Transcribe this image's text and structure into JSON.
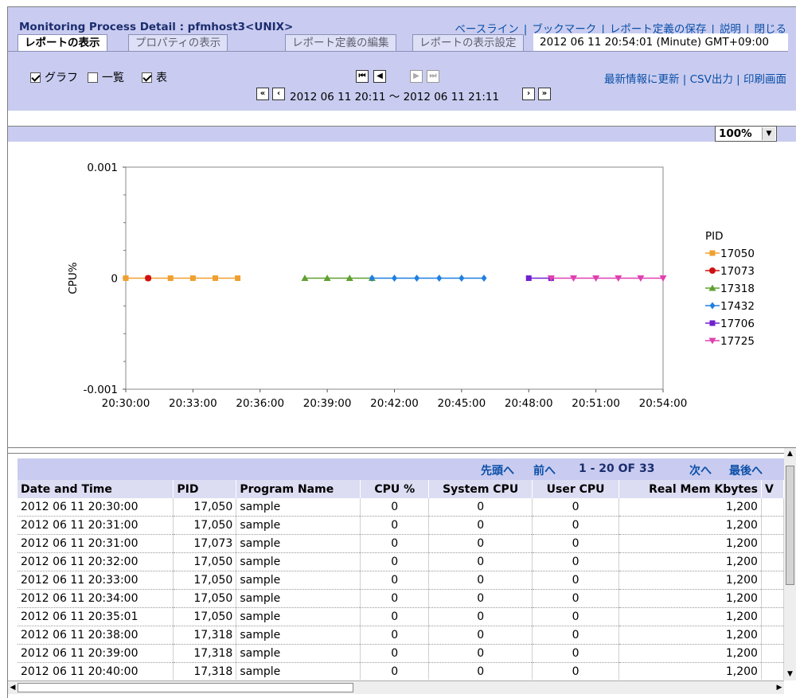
{
  "header": {
    "title": "Monitoring Process Detail : pfmhost3<UNIX>",
    "top_links": [
      "ベースライン",
      "ブックマーク",
      "レポート定義の保存",
      "説明",
      "閉じる"
    ],
    "tabs": [
      "レポートの表示",
      "プロパティの表示",
      "レポート定義の編集",
      "レポートの表示設定"
    ],
    "report_time": "2012 06 11 20:54:01  (Minute)  GMT+09:00",
    "checkboxes": [
      {
        "label": "グラフ",
        "checked": true
      },
      {
        "label": "一覧",
        "checked": false
      },
      {
        "label": "表",
        "checked": true
      }
    ],
    "range_text": "2012 06 11 20:11 ～ 2012 06 11 21:11",
    "right_links": [
      "最新情報に更新",
      "CSV出力",
      "印刷画面"
    ]
  },
  "graph": {
    "zoom": "100%"
  },
  "chart_data": {
    "type": "line",
    "ylabel": "CPU%",
    "xlabel": "",
    "ylim": [
      -0.001,
      0.001
    ],
    "yticks": [
      "0.001",
      "0",
      "-0.001"
    ],
    "xticks": [
      "20:30:00",
      "20:33:00",
      "20:36:00",
      "20:39:00",
      "20:42:00",
      "20:45:00",
      "20:48:00",
      "20:51:00",
      "20:54:00"
    ],
    "legend_title": "PID",
    "legend_position": "right",
    "series": [
      {
        "name": "17050",
        "color": "#f0a030",
        "marker": "square",
        "x": [
          "20:30:00",
          "20:31:00",
          "20:32:00",
          "20:33:00",
          "20:34:00",
          "20:35:00"
        ],
        "y": [
          0,
          0,
          0,
          0,
          0,
          0
        ]
      },
      {
        "name": "17073",
        "color": "#d01010",
        "marker": "circle",
        "x": [
          "20:31:00"
        ],
        "y": [
          0
        ]
      },
      {
        "name": "17318",
        "color": "#60a030",
        "marker": "triangle",
        "x": [
          "20:38:00",
          "20:39:00",
          "20:40:00",
          "20:41:00"
        ],
        "y": [
          0,
          0,
          0,
          0
        ]
      },
      {
        "name": "17432",
        "color": "#2080e0",
        "marker": "diamond",
        "x": [
          "20:41:00",
          "20:42:00",
          "20:43:00",
          "20:44:00",
          "20:45:00",
          "20:46:00"
        ],
        "y": [
          0,
          0,
          0,
          0,
          0,
          0
        ]
      },
      {
        "name": "17706",
        "color": "#7020d0",
        "marker": "square",
        "x": [
          "20:48:00",
          "20:49:00"
        ],
        "y": [
          0,
          0
        ]
      },
      {
        "name": "17725",
        "color": "#e040b0",
        "marker": "triangle-down",
        "x": [
          "20:49:00",
          "20:50:00",
          "20:51:00",
          "20:52:00",
          "20:53:00",
          "20:54:00"
        ],
        "y": [
          0,
          0,
          0,
          0,
          0,
          0
        ]
      }
    ]
  },
  "pager": {
    "first": "先頭へ",
    "prev": "前へ",
    "range": "1 - 20 OF 33",
    "next": "次へ",
    "last": "最後へ"
  },
  "table": {
    "columns": [
      "Date and Time",
      "PID",
      "Program Name",
      "CPU %",
      "System CPU",
      "User CPU",
      "Real Mem Kbytes",
      "V"
    ],
    "rows": [
      [
        "2012 06 11 20:30:00",
        "17,050",
        "sample",
        "0",
        "0",
        "0",
        "1,200"
      ],
      [
        "2012 06 11 20:31:00",
        "17,050",
        "sample",
        "0",
        "0",
        "0",
        "1,200"
      ],
      [
        "2012 06 11 20:31:00",
        "17,073",
        "sample",
        "0",
        "0",
        "0",
        "1,200"
      ],
      [
        "2012 06 11 20:32:00",
        "17,050",
        "sample",
        "0",
        "0",
        "0",
        "1,200"
      ],
      [
        "2012 06 11 20:33:00",
        "17,050",
        "sample",
        "0",
        "0",
        "0",
        "1,200"
      ],
      [
        "2012 06 11 20:34:00",
        "17,050",
        "sample",
        "0",
        "0",
        "0",
        "1,200"
      ],
      [
        "2012 06 11 20:35:01",
        "17,050",
        "sample",
        "0",
        "0",
        "0",
        "1,200"
      ],
      [
        "2012 06 11 20:38:00",
        "17,318",
        "sample",
        "0",
        "0",
        "0",
        "1,200"
      ],
      [
        "2012 06 11 20:39:00",
        "17,318",
        "sample",
        "0",
        "0",
        "0",
        "1,200"
      ],
      [
        "2012 06 11 20:40:00",
        "17,318",
        "sample",
        "0",
        "0",
        "0",
        "1,200"
      ]
    ]
  }
}
